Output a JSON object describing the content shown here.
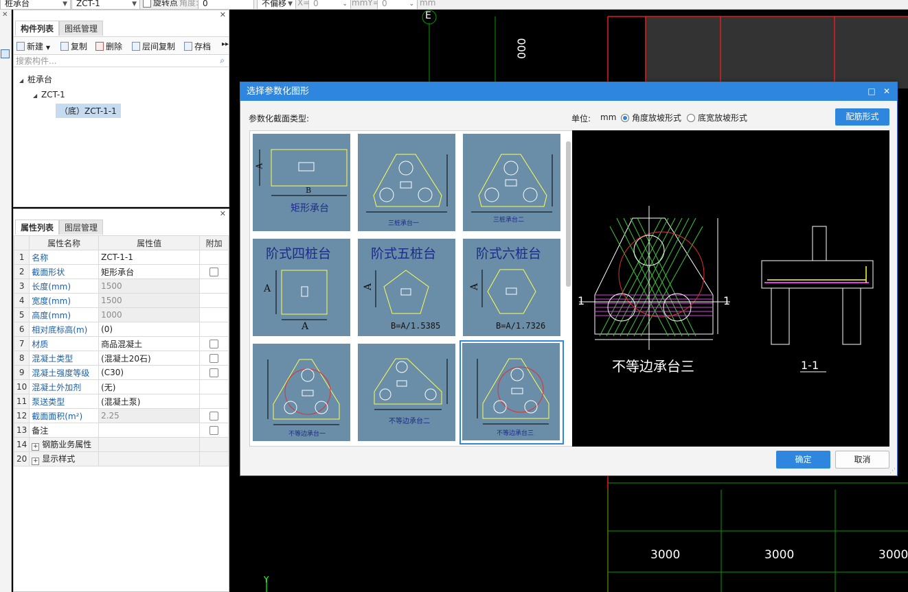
{
  "toolbar": {
    "type_value": "桩承台",
    "element_value": "ZCT-1",
    "rotate_label": "旋转点",
    "angle_label": "角度:",
    "angle_value": "0",
    "offset_value": "不偏移",
    "x_label": "X=",
    "x_value": "0",
    "mmy_label": "mmY=",
    "y_value": "0",
    "mm_label": "mm"
  },
  "component_panel": {
    "tabs": [
      "构件列表",
      "图纸管理"
    ],
    "actions": [
      "新建",
      "复制",
      "删除",
      "层间复制",
      "存档"
    ],
    "search_placeholder": "搜索构件...",
    "tree": {
      "root": "桩承台",
      "child": "ZCT-1",
      "leaf": "（底）ZCT-1-1"
    }
  },
  "property_panel": {
    "tabs": [
      "属性列表",
      "图层管理"
    ],
    "headers": {
      "name": "属性名称",
      "value": "属性值",
      "extra": "附加"
    },
    "rows": [
      {
        "no": "1",
        "name": "名称",
        "value": "ZCT-1-1"
      },
      {
        "no": "2",
        "name": "截面形状",
        "value": "矩形承台"
      },
      {
        "no": "3",
        "name": "长度(mm)",
        "value": "1500"
      },
      {
        "no": "4",
        "name": "宽度(mm)",
        "value": "1500"
      },
      {
        "no": "5",
        "name": "高度(mm)",
        "value": "1000"
      },
      {
        "no": "6",
        "name": "相对底标高(m)",
        "value": "(0)"
      },
      {
        "no": "7",
        "name": "材质",
        "value": "商品混凝土"
      },
      {
        "no": "8",
        "name": "混凝土类型",
        "value": "(混凝土20石)"
      },
      {
        "no": "9",
        "name": "混凝土强度等级",
        "value": "(C30)"
      },
      {
        "no": "10",
        "name": "混凝土外加剂",
        "value": "(无)"
      },
      {
        "no": "11",
        "name": "泵送类型",
        "value": "(混凝土泵)"
      },
      {
        "no": "12",
        "name": "截面面积(m²)",
        "value": "2.25"
      },
      {
        "no": "13",
        "name": "备注",
        "value": ""
      },
      {
        "no": "14",
        "name": "钢筋业务属性",
        "value": ""
      },
      {
        "no": "20",
        "name": "显示样式",
        "value": ""
      }
    ]
  },
  "canvas": {
    "axis_label": "E",
    "dim_vertical": "000",
    "dims": [
      "3000",
      "3000",
      "3000"
    ],
    "y_axis": "Y"
  },
  "dialog": {
    "title": "选择参数化图形",
    "section_label": "参数化截面类型:",
    "unit_label": "单位:",
    "unit_value": "mm",
    "option_angle": "角度放坡形式",
    "option_width": "底宽放坡形式",
    "rebar_button": "配筋形式",
    "ok_button": "确定",
    "cancel_button": "取消",
    "shapes": [
      {
        "title": "矩形承台",
        "labels": [
          "A",
          "B"
        ]
      },
      {
        "title": "三桩承台一",
        "labels": []
      },
      {
        "title": "三桩承台二",
        "labels": []
      },
      {
        "title": "阶式四桩台",
        "labels": [
          "A",
          "A"
        ]
      },
      {
        "title": "阶式五桩台",
        "labels": [
          "A",
          "B=A/1.5385"
        ]
      },
      {
        "title": "阶式六桩台",
        "labels": [
          "A",
          "B=A/1.7326"
        ]
      },
      {
        "title": "不等边承台一",
        "labels": []
      },
      {
        "title": "不等边承台二",
        "labels": []
      },
      {
        "title": "不等边承台三",
        "labels": []
      }
    ],
    "preview": {
      "title": "不等边承台三",
      "section": "1-1",
      "marks": [
        "1",
        "1"
      ]
    }
  }
}
